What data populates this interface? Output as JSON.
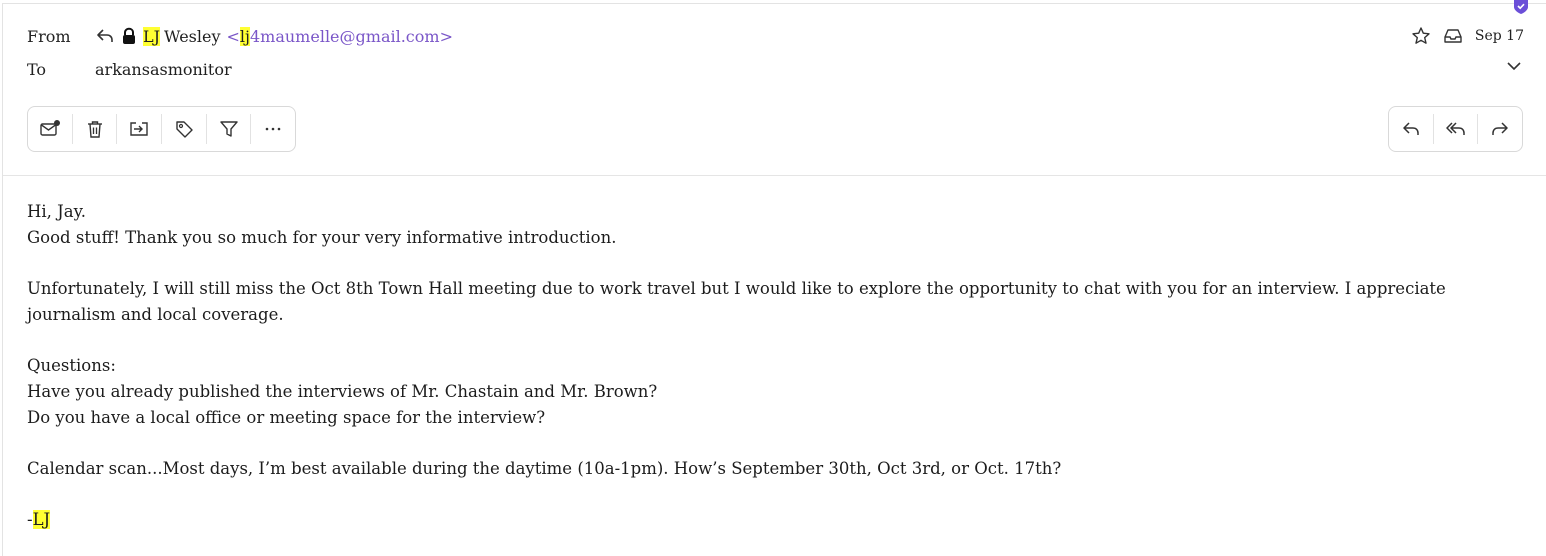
{
  "header": {
    "from_label": "From",
    "to_label": "To",
    "sender_initials": "LJ",
    "sender_last_name": "Wesley",
    "addr_open": "<",
    "addr_highlight": "lj",
    "addr_rest": "4maumelle@gmail.com>",
    "recipient": "arkansasmonitor",
    "date": "Sep 17"
  },
  "icons": {
    "reply_small": "reply-arrow-icon",
    "lock": "lock-icon",
    "star": "star-icon",
    "inbox": "inbox-icon",
    "expand": "chevron-down-icon",
    "badge": "shield-check-icon"
  },
  "toolbar": {
    "left": [
      "mark-unread-icon",
      "trash-icon",
      "move-to-folder-icon",
      "tag-icon",
      "filter-icon",
      "more-icon"
    ],
    "right": [
      "reply-icon",
      "reply-all-icon",
      "forward-icon"
    ]
  },
  "body": {
    "line1": "Hi, Jay.",
    "line2": "Good stuff! Thank you so much for your very informative introduction.",
    "para2": "Unfortunately, I will still miss the Oct 8th Town Hall meeting due to work travel but I would like to explore the opportunity to chat with you for an interview. I appreciate journalism and local coverage.",
    "q_label": "Questions:",
    "q1": "Have you already published the interviews of Mr. Chastain and Mr. Brown?",
    "q2": "Do you have a local office or meeting space for the interview?",
    "calendar": "Calendar scan...Most days, I’m best available during the daytime (10a-1pm). How’s September 30th, Oct 3rd, or Oct. 17th?",
    "sig_dash": "-",
    "sig_initials": "LJ"
  },
  "colors": {
    "highlight": "#ffff33",
    "accent_purple": "#7a56c8",
    "badge_purple": "#6b4fd8"
  }
}
